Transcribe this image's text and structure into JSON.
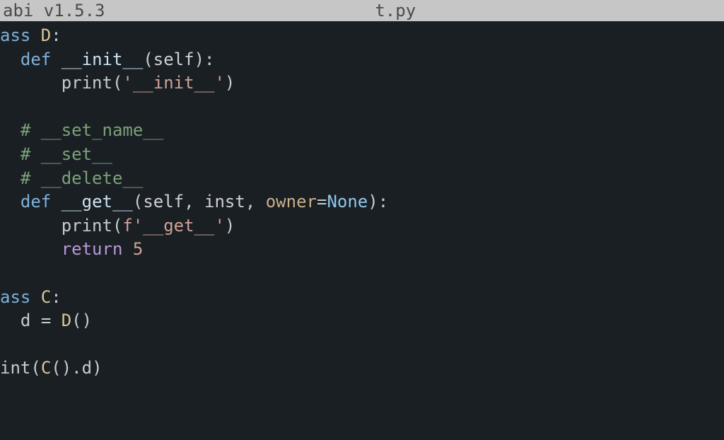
{
  "titlebar": {
    "app_left": "abi v1.5.3",
    "filename": "t.py"
  },
  "code": {
    "l1": {
      "kw": "ass ",
      "name": "D",
      "colon": ":"
    },
    "l2": {
      "indent": "  ",
      "kw": "def",
      "sp": " ",
      "fn": "__init__",
      "lparen": "(",
      "self": "self",
      "rparen": ")",
      "colon": ":"
    },
    "l3": {
      "indent": "      ",
      "call": "print",
      "lparen": "(",
      "str": "'__init__'",
      "rparen": ")"
    },
    "l4": {
      "blank": " "
    },
    "l5": {
      "indent": "  ",
      "comment": "# __set_name__"
    },
    "l6": {
      "indent": "  ",
      "comment": "# __set__"
    },
    "l7": {
      "indent": "  ",
      "comment": "# __delete__"
    },
    "l8": {
      "indent": "  ",
      "kw": "def",
      "sp": " ",
      "fn": "__get__",
      "lparen": "(",
      "self": "self",
      "c1": ", ",
      "p1": "inst",
      "c2": ", ",
      "p2": "owner",
      "eq": "=",
      "none": "None",
      "rparen": ")",
      "colon": ":"
    },
    "l9": {
      "indent": "      ",
      "call": "print",
      "lparen": "(",
      "fpre": "f",
      "str": "'__get__'",
      "rparen": ")"
    },
    "l10": {
      "indent": "      ",
      "kw": "return",
      "sp": " ",
      "num": "5"
    },
    "l11": {
      "blank": " "
    },
    "l12": {
      "kw": "ass ",
      "name": "C",
      "colon": ":"
    },
    "l13": {
      "indent": "  ",
      "lhs": "d ",
      "eq": "=",
      "sp": " ",
      "call": "D",
      "lparen": "(",
      "rparen": ")"
    },
    "l14": {
      "blank": " "
    },
    "l15": {
      "pre": "int",
      "lparen": "(",
      "call": "C",
      "lp2": "(",
      "rp2": ")",
      "dot": ".",
      "attr": "d",
      "rparen": ")"
    }
  }
}
